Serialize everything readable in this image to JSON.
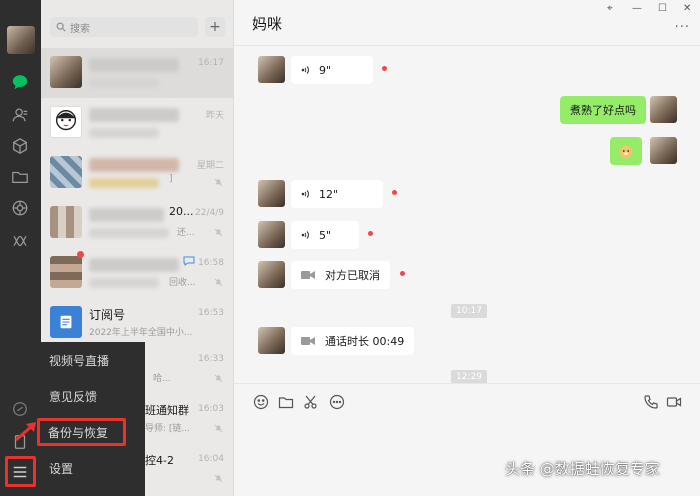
{
  "search": {
    "placeholder": "搜索",
    "add_label": "+"
  },
  "chat_list": [
    {
      "time": "16:17",
      "muted": false
    },
    {
      "time": "昨天",
      "muted": false
    },
    {
      "time": "星期二",
      "muted": true,
      "fragment": "]"
    },
    {
      "time": "22/4/9",
      "muted": true,
      "fragment_title": "20...",
      "fragment_sub": "还..."
    },
    {
      "time": "16:58",
      "muted": true,
      "fragment_sub": "回收..."
    },
    {
      "title": "订阅号",
      "time": "16:53",
      "preview": "2022年上半年全国中小..."
    },
    {
      "time": "16:33",
      "muted": true,
      "fragment_sub": "哈..."
    },
    {
      "time": "16:03",
      "muted": true,
      "fragment_title": "班通知群",
      "fragment_sub": "导师: [链..."
    },
    {
      "time": "16:04",
      "muted": true,
      "fragment_title": "控4-2"
    }
  ],
  "menu": {
    "items": [
      "视频号直播",
      "意见反馈",
      "备份与恢复",
      "设置"
    ]
  },
  "chat": {
    "contact_name": "妈咪",
    "window_controls": [
      "⌖",
      "—",
      "☐",
      "✕"
    ],
    "more": "···",
    "messages": [
      {
        "side": "them",
        "kind": "voice",
        "text": "9\""
      },
      {
        "side": "me",
        "kind": "text",
        "text": "煮熟了好点吗"
      },
      {
        "side": "me",
        "kind": "sticker",
        "text": ""
      },
      {
        "side": "them",
        "kind": "voice",
        "text": "12\""
      },
      {
        "side": "them",
        "kind": "voice",
        "text": "5\""
      },
      {
        "side": "them",
        "kind": "video",
        "text": "对方已取消"
      },
      {
        "side": "time",
        "kind": "time",
        "text": "10:17"
      },
      {
        "side": "them",
        "kind": "video",
        "text": "通话时长 00:49"
      },
      {
        "side": "time",
        "kind": "time",
        "text": "12:29"
      }
    ]
  },
  "watermark": "头条 @数据蛙恢复专家",
  "colors": {
    "sidebar": "#2e2e2e",
    "accent_green": "#07c160",
    "bubble_me": "#95ec69",
    "unread": "#f04848",
    "highlight": "#e8322d"
  }
}
